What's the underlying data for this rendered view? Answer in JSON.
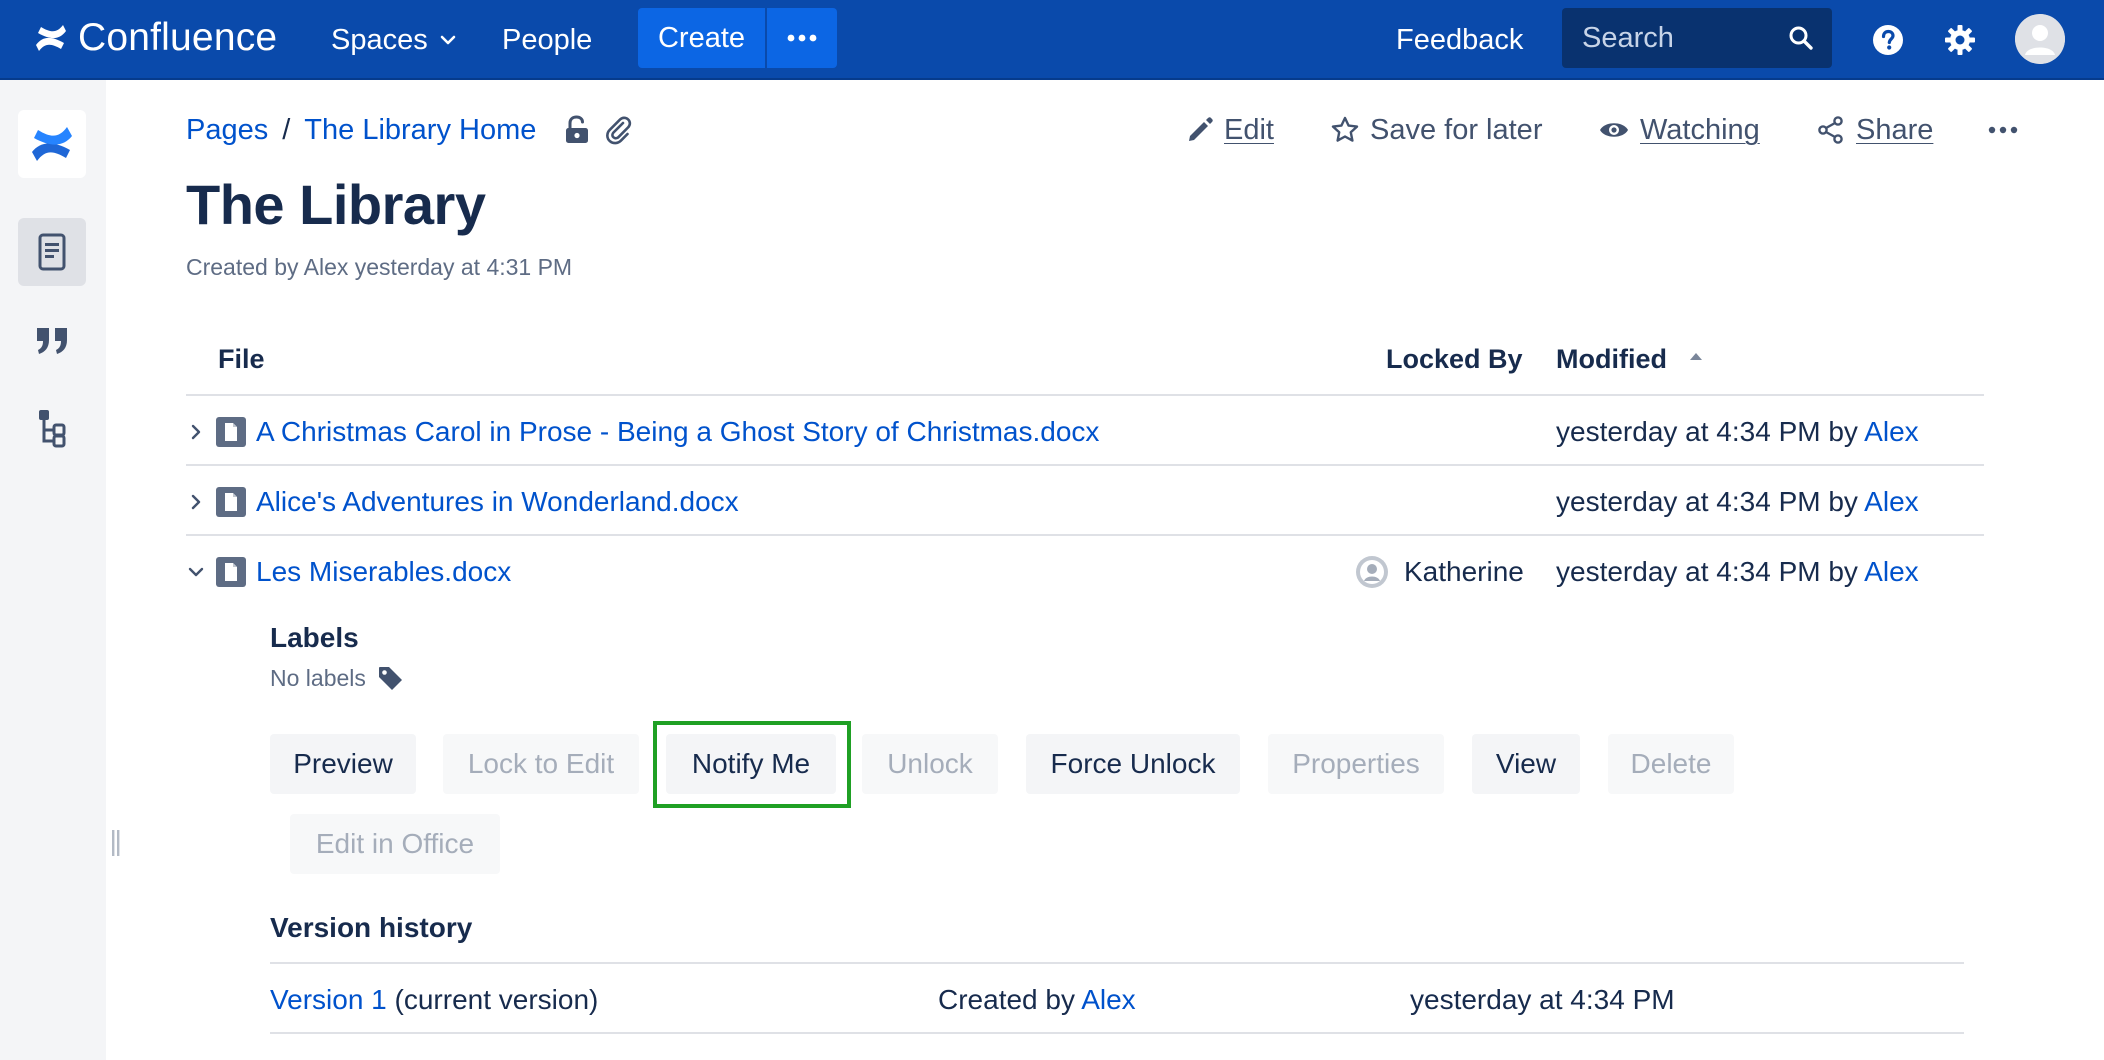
{
  "app": {
    "name": "Confluence",
    "nav": {
      "spaces": "Spaces",
      "people": "People",
      "create": "Create",
      "feedback": "Feedback",
      "search_placeholder": "Search"
    },
    "colors": {
      "nav_bg": "#0a4aab",
      "create_bg": "#0c66e4",
      "link": "#0052cc",
      "highlight": "#1fa024"
    }
  },
  "sidebar": {
    "items": [
      {
        "name": "confluence-logo-icon"
      },
      {
        "name": "pages-icon",
        "active": true
      },
      {
        "name": "blog-quote-icon"
      },
      {
        "name": "page-tree-icon"
      }
    ]
  },
  "breadcrumb": {
    "root": "Pages",
    "separator": "/",
    "current": "The Library Home"
  },
  "page_actions": {
    "edit": "Edit",
    "save_for_later": "Save for later",
    "watching": "Watching",
    "share": "Share"
  },
  "page": {
    "title": "The Library",
    "byline": "Created by Alex yesterday at 4:31 PM"
  },
  "table": {
    "headers": {
      "file": "File",
      "locked_by": "Locked By",
      "modified": "Modified"
    },
    "rows": [
      {
        "file": "A Christmas Carol in Prose - Being a Ghost Story of Christmas.docx",
        "locked_by": "",
        "modified_text": "yesterday at 4:34 PM by",
        "modified_user": "Alex",
        "expanded": false
      },
      {
        "file": "Alice's Adventures in Wonderland.docx",
        "locked_by": "",
        "modified_text": "yesterday at 4:34 PM by",
        "modified_user": "Alex",
        "expanded": false
      },
      {
        "file": "Les Miserables.docx",
        "locked_by": "Katherine",
        "modified_text": "yesterday at 4:34 PM by",
        "modified_user": "Alex",
        "expanded": true
      }
    ]
  },
  "details": {
    "labels_heading": "Labels",
    "no_labels": "No labels",
    "buttons": {
      "preview": "Preview",
      "lock_to_edit": "Lock to Edit",
      "notify_me": "Notify Me",
      "unlock": "Unlock",
      "force_unlock": "Force Unlock",
      "properties": "Properties",
      "view": "View",
      "delete": "Delete",
      "edit_in_office": "Edit in Office"
    },
    "version_history": {
      "heading": "Version history",
      "versions": [
        {
          "version": "Version 1",
          "note": "(current version)",
          "created_by_text": "Created by",
          "created_by_user": "Alex",
          "date": "yesterday at 4:34 PM"
        }
      ]
    }
  }
}
